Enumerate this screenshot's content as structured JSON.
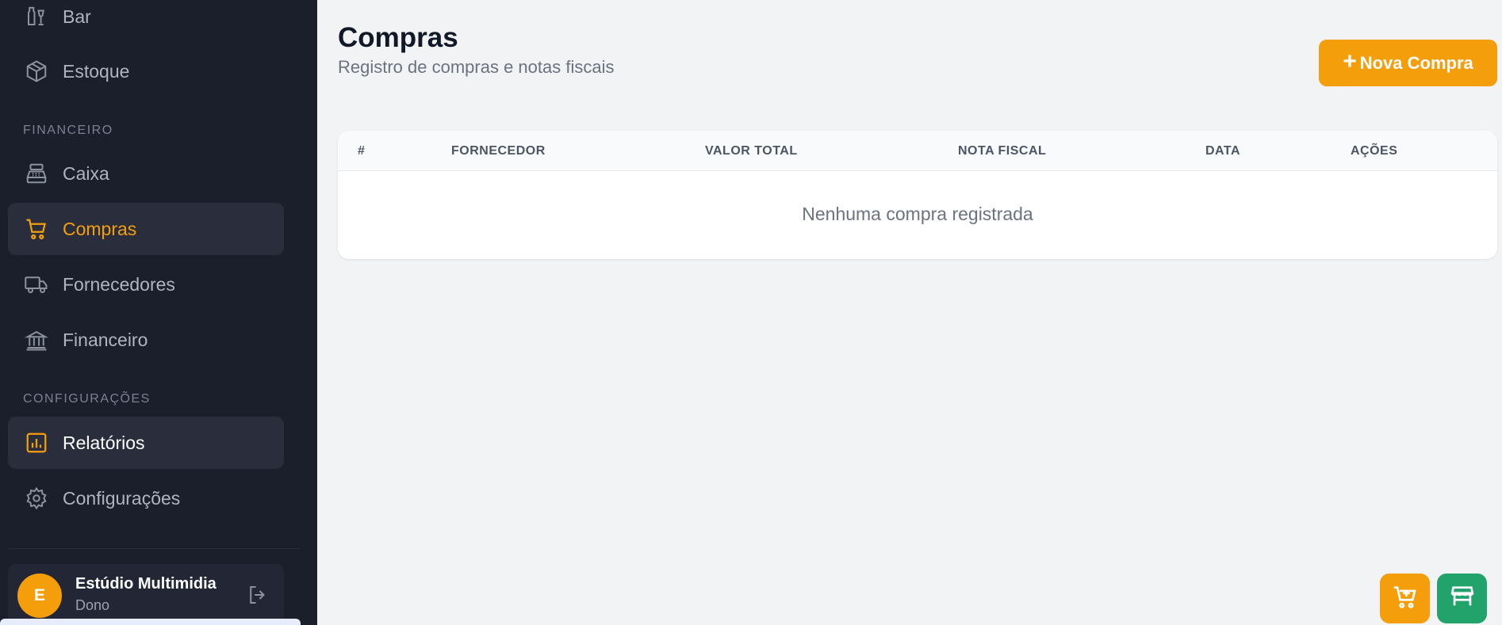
{
  "sidebar": {
    "items": [
      {
        "label": "Bar",
        "icon": "bottle-icon"
      },
      {
        "label": "Estoque",
        "icon": "box-icon"
      },
      {
        "label": "Caixa",
        "icon": "cash-register-icon"
      },
      {
        "label": "Compras",
        "icon": "cart-icon"
      },
      {
        "label": "Fornecedores",
        "icon": "truck-icon"
      },
      {
        "label": "Financeiro",
        "icon": "bank-icon"
      },
      {
        "label": "Relatórios",
        "icon": "bar-chart-icon"
      },
      {
        "label": "Configurações",
        "icon": "gear-icon"
      }
    ],
    "sections": {
      "financeiro": "FINANCEIRO",
      "configuracoes": "CONFIGURAÇÕES"
    },
    "user": {
      "initial": "E",
      "name": "Estúdio Multimidia",
      "role": "Dono"
    }
  },
  "main": {
    "title": "Compras",
    "subtitle": "Registro de compras e notas fiscais",
    "new_button": {
      "plus": "+",
      "label": "Nova Compra"
    },
    "table": {
      "headers": [
        "#",
        "FORNECEDOR",
        "VALOR TOTAL",
        "NOTA FISCAL",
        "DATA",
        "AÇÕES"
      ],
      "empty_message": "Nenhuma compra registrada"
    }
  },
  "colors": {
    "sidebar_bg": "#1b1e2b",
    "accent": "#f59e0b",
    "green": "#22a36b",
    "page_bg": "#f2f3f5"
  }
}
